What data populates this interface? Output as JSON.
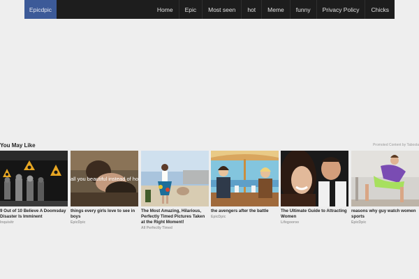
{
  "navbar": {
    "brand": "Epicdpic",
    "items": [
      "Home",
      "Epic",
      "Most seen",
      "hot",
      "Meme",
      "funny",
      "Privacy Policy",
      "Chicks"
    ]
  },
  "you_may_like": {
    "title": "You May Like",
    "sponsor": "Promoted Content by Taboola",
    "cards": [
      {
        "title": "9 Out of 10 Believe A Doomsday Disaster Is Imminent",
        "source": "Inquisitr"
      },
      {
        "title": "things every girls love to see in boys",
        "source": "EpicDpic",
        "image_caption": "all you beautiful instead of ho"
      },
      {
        "title": "The Most Amazing, Hilarious, Perfectly Timed Pictures Taken at the Right Moment!",
        "source": "All Perfectly Timed"
      },
      {
        "title": "the avengers after the battle",
        "source": "EpicDpic"
      },
      {
        "title": "The Ultimate Guide to Attracting Women",
        "source": "Lifegooroo"
      },
      {
        "title": "reasons why guy watch women sports",
        "source": "EpicDpic"
      }
    ]
  },
  "colors": {
    "navbar": "#1d1d1d",
    "brand": "#3c5a98",
    "background": "#eeeeee"
  }
}
